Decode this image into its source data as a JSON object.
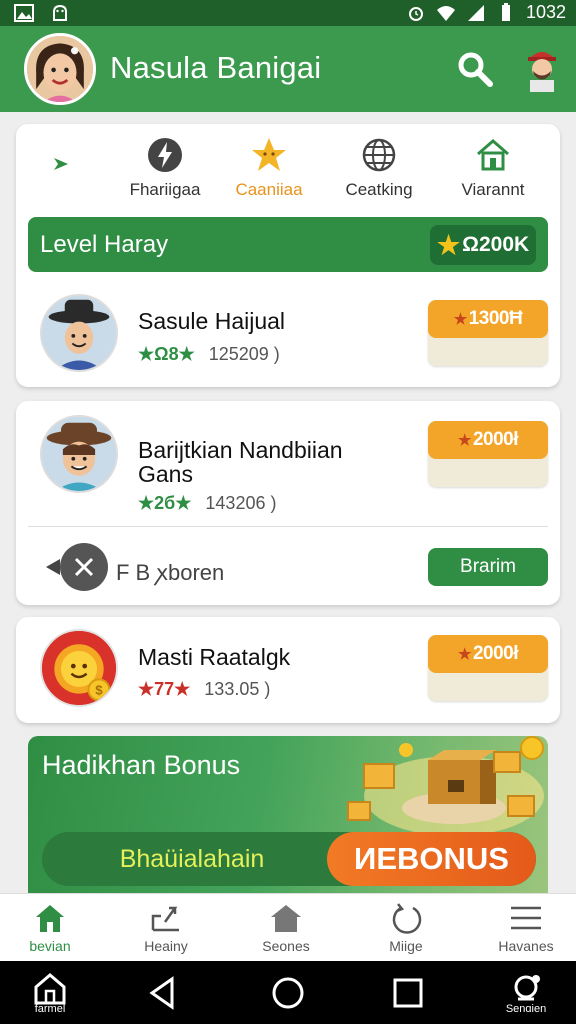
{
  "status_bar": {
    "time": "1032"
  },
  "app_bar": {
    "title": "Nasula Banigai"
  },
  "tabs": [
    {
      "label": "Fhariigaa",
      "icon": "flash-icon"
    },
    {
      "label": "Caaniiaa",
      "icon": "star-icon",
      "active": true
    },
    {
      "label": "Ceatking",
      "icon": "globe-icon"
    },
    {
      "label": "Viarannt",
      "icon": "house-icon"
    }
  ],
  "level_bar": {
    "title": "Level Haray",
    "value": "Ω200K"
  },
  "rows": [
    {
      "name": "Sasule Haijual",
      "stars": "★Ω8★",
      "score": "125209 )",
      "button": "1300Ħ"
    },
    {
      "name": "Barijtkian Nandbiian",
      "name2": "Gans",
      "stars": "★2б★",
      "score": "143206 )",
      "button": "2000ł"
    },
    {
      "name": "Masti Raatalgk",
      "stars": "★77★",
      "score": "133.05 )",
      "button": "2000ł"
    }
  ],
  "follow_row": {
    "label": "F B ꭗboren",
    "button": "Brarim"
  },
  "bonus": {
    "title": "Hadikhan Bonus",
    "left_text": "Bhaüialahain",
    "right_text": "ИEBONUS"
  },
  "bottom_nav": [
    {
      "label": "bevian",
      "icon": "home-icon",
      "active": true
    },
    {
      "label": "Heainy",
      "icon": "share-icon"
    },
    {
      "label": "Seones",
      "icon": "house-icon"
    },
    {
      "label": "Miige",
      "icon": "refresh-icon"
    },
    {
      "label": "Havanes",
      "icon": "menu-icon"
    }
  ],
  "system_nav": {
    "left_label": "farmel",
    "right_label": "Senɑien"
  },
  "colors": {
    "primary": "#3c9a4e",
    "dark_green": "#2f8e44",
    "orange": "#f3a52a",
    "accent_text": "#e8931c"
  }
}
